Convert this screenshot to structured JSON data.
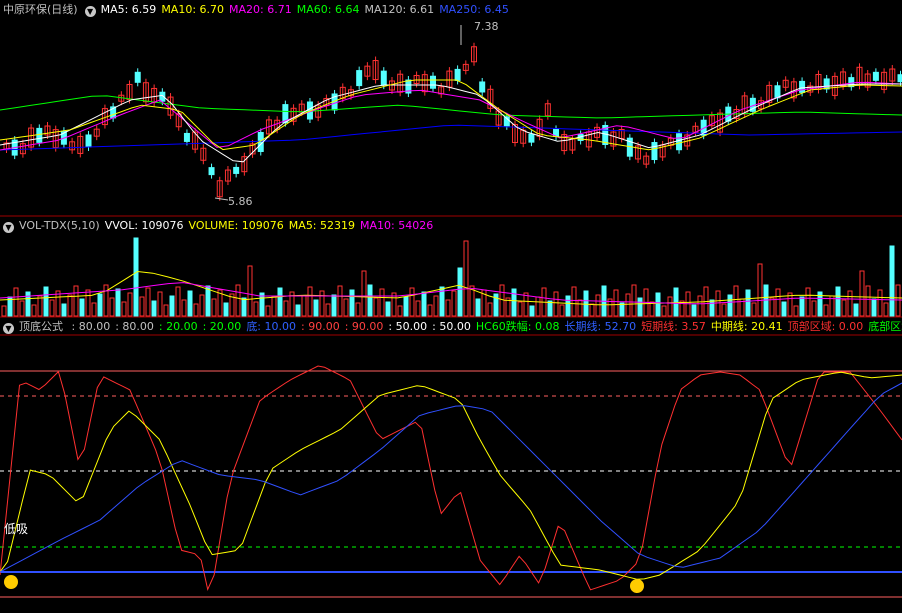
{
  "price_panel": {
    "title": "中原环保(日线)",
    "ma5": "MA5: 6.59",
    "ma10": "MA10: 6.70",
    "ma20": "MA20: 6.71",
    "ma60": "MA60: 6.64",
    "ma120": "MA120: 6.61",
    "ma250": "MA250: 6.45",
    "high_label": "7.38",
    "low_label": "5.86",
    "colors": {
      "ma5": "#ffffff",
      "ma10": "#ffff00",
      "ma20": "#ff00ff",
      "ma60": "#00ff00",
      "ma120": "#c0c0c0",
      "ma250": "#0000ff",
      "up": "#ff3232",
      "down": "#54ffff"
    }
  },
  "volume_panel": {
    "title": "VOL-TDX(5,10)",
    "vvol": "VVOL: 109076",
    "volume": "VOLUME: 109076",
    "ma5": "MA5: 52319",
    "ma10": "MA10: 54026"
  },
  "indicator_panel": {
    "title": "顶底公式",
    "items": [
      {
        "text": ": 80.00",
        "color": "#c0c0c0"
      },
      {
        "text": ": 80.00",
        "color": "#c0c0c0"
      },
      {
        "text": ": 20.00",
        "color": "#00ff00"
      },
      {
        "text": ": 20.00",
        "color": "#00ff00"
      },
      {
        "text": "底: 10.00",
        "color": "#3060ff"
      },
      {
        "text": ": 90.00",
        "color": "#ff4040"
      },
      {
        "text": ": 90.00",
        "color": "#ff4040"
      },
      {
        "text": ": 50.00",
        "color": "#ffffff"
      },
      {
        "text": ": 50.00",
        "color": "#ffffff"
      },
      {
        "text": "HC60跌幅: 0.08",
        "color": "#00ff00"
      },
      {
        "text": "长期线: 52.70",
        "color": "#3060ff"
      },
      {
        "text": "短期线: 3.57",
        "color": "#ff3030"
      },
      {
        "text": "中期线: 20.41",
        "color": "#ffff00"
      },
      {
        "text": "顶部区域: 0.00",
        "color": "#ff3030"
      },
      {
        "text": "底部区域",
        "color": "#00ff00"
      }
    ],
    "buy_label": "低吸"
  }
}
